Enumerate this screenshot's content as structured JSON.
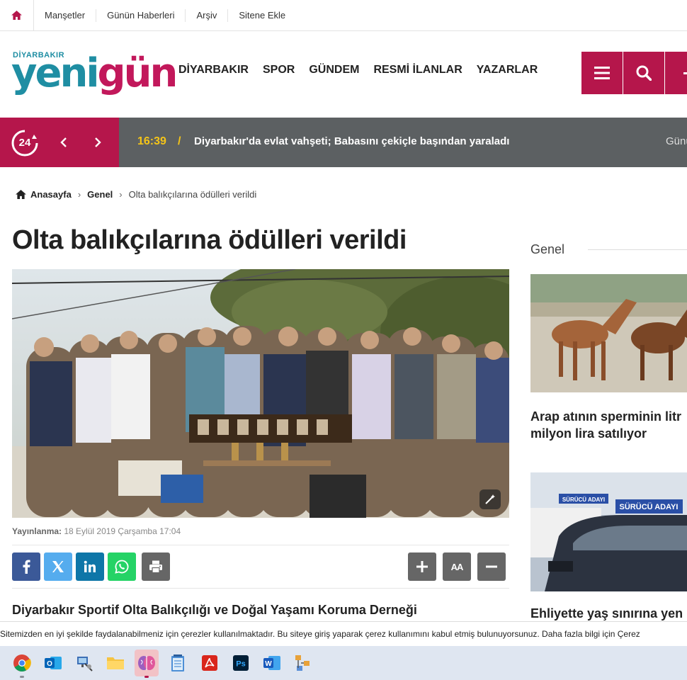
{
  "topbar": {
    "links": [
      "Manşetler",
      "Günün Haberleri",
      "Arşiv",
      "Sitene Ekle"
    ]
  },
  "logo": {
    "small": "DİYARBAKIR",
    "part1": "yeni",
    "part2": "gün"
  },
  "nav": [
    "DİYARBAKIR",
    "SPOR",
    "GÜNDEM",
    "RESMİ İLANLAR",
    "YAZARLAR"
  ],
  "ticker": {
    "badge": "24",
    "time": "16:39",
    "slash": "/",
    "headline": "Diyarbakır'da evlat vahşeti; Babasını çekiçle başından yaraladı",
    "next": "Günü"
  },
  "breadcrumb": {
    "home": "Anasayfa",
    "category": "Genel",
    "current": "Olta balıkçılarına ödülleri verildi"
  },
  "article": {
    "title": "Olta balıkçılarına ödülleri verildi",
    "published_label": "Yayınlanma:",
    "published_date": "18 Eylül 2019 Çarşamba 17:04",
    "font_label": "AA",
    "lead": "Diyarbakır Sportif Olta Balıkçılığı ve Doğal Yaşamı Koruma Derneği"
  },
  "sidebar": {
    "heading": "Genel",
    "items": [
      {
        "line1": "Arap atının sperminin litr",
        "line2": "milyon lira satılıyor"
      },
      {
        "line1": "Ehliyette yaş sınırına yen",
        "sign": "SÜRÜCÜ ADAYI",
        "sign_small": "SÜRÜCÜ ADAYI"
      }
    ]
  },
  "cookie": {
    "text": "Sitemizden en iyi şekilde faydalanabilmeniz için çerezler kullanılmaktadır. Bu siteye giriş yaparak çerez kullanımını kabul etmiş bulunuyorsunuz. Daha fazla bilgi için Çerez"
  },
  "taskbar": {
    "icons": [
      "chrome-icon",
      "outlook-icon",
      "network-tool-icon",
      "file-explorer-icon",
      "brain-app-icon",
      "notepad-icon",
      "acrobat-icon",
      "photoshop-icon",
      "word-icon",
      "diagram-tool-icon"
    ],
    "ps_label": "Ps",
    "word_label": "W"
  },
  "colors": {
    "brand": "#b5164b",
    "teal": "#1f8ea3",
    "ticker_bg": "#5c6062",
    "time": "#f5c518"
  }
}
